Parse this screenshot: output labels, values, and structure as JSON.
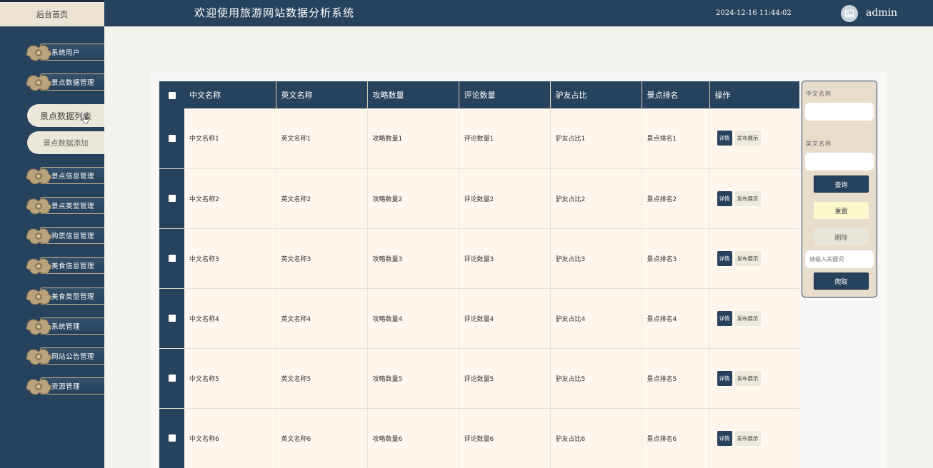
{
  "header": {
    "home_tab": "后台首页",
    "title": "欢迎使用旅游网站数据分析系统",
    "datetime": "2024-12-16 11:44:02",
    "username": "admin"
  },
  "sidebar": {
    "items": [
      {
        "label": "系统用户"
      },
      {
        "label": "景点数据管理"
      },
      {
        "label": "景点信息管理"
      },
      {
        "label": "景点类型管理"
      },
      {
        "label": "购票信息管理"
      },
      {
        "label": "美食信息管理"
      },
      {
        "label": "美食类型管理"
      },
      {
        "label": "系统管理"
      },
      {
        "label": "网站公告管理"
      },
      {
        "label": "资源管理"
      }
    ],
    "subitems": [
      {
        "label": "景点数据列表"
      },
      {
        "label": "景点数据添加"
      }
    ]
  },
  "table": {
    "headers": [
      "中文名称",
      "英文名称",
      "攻略数量",
      "评论数量",
      "驴友占比",
      "景点排名",
      "操作"
    ],
    "rows": [
      [
        "中文名称1",
        "英文名称1",
        "攻略数量1",
        "评论数量1",
        "驴友占比1",
        "景点排名1"
      ],
      [
        "中文名称2",
        "英文名称2",
        "攻略数量2",
        "评论数量2",
        "驴友占比2",
        "景点排名2"
      ],
      [
        "中文名称3",
        "英文名称3",
        "攻略数量3",
        "评论数量3",
        "驴友占比3",
        "景点排名3"
      ],
      [
        "中文名称4",
        "英文名称4",
        "攻略数量4",
        "评论数量4",
        "驴友占比4",
        "景点排名4"
      ],
      [
        "中文名称5",
        "英文名称5",
        "攻略数量5",
        "评论数量5",
        "驴友占比5",
        "景点排名5"
      ],
      [
        "中文名称6",
        "英文名称6",
        "攻略数量6",
        "评论数量6",
        "驴友占比6",
        "景点排名6"
      ]
    ],
    "detail_label": "详情",
    "publish_label": "发布展示"
  },
  "search": {
    "cn_label": "中文名称",
    "en_label": "英文名称",
    "query_label": "查询",
    "reset_label": "重置",
    "delete_label": "删除",
    "keyword_placeholder": "请输入关键词",
    "crawl_label": "爬取"
  },
  "colors": {
    "primary": "#27425c",
    "cream": "#fff6ee",
    "panel": "#e8dccd",
    "accent_gold": "#c7b08a"
  }
}
